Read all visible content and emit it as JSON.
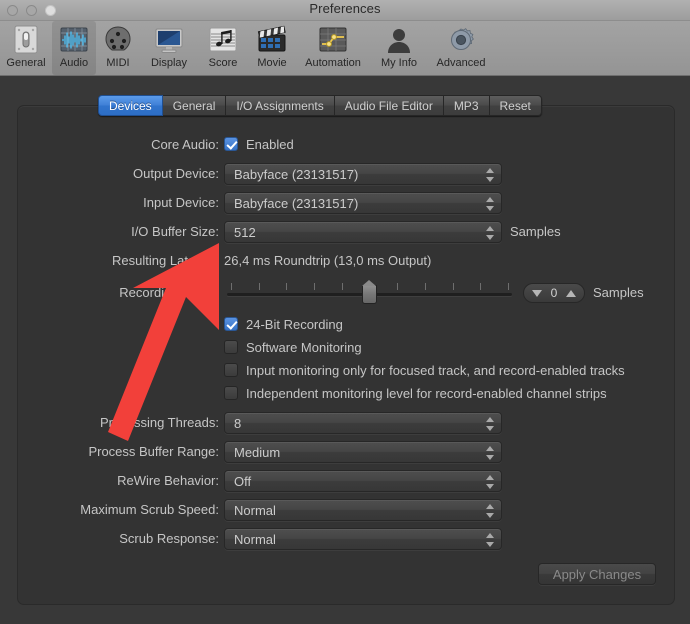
{
  "window": {
    "title": "Preferences",
    "traffic_lights": [
      "close",
      "minimize",
      "zoom"
    ]
  },
  "toolbar": {
    "items": [
      {
        "label": "General",
        "icon": "general-switch-icon",
        "selected": false
      },
      {
        "label": "Audio",
        "icon": "audio-waveform-icon",
        "selected": true
      },
      {
        "label": "MIDI",
        "icon": "midi-din-plug-icon",
        "selected": false
      },
      {
        "label": "Display",
        "icon": "display-monitor-icon",
        "selected": false
      },
      {
        "label": "Score",
        "icon": "score-notes-icon",
        "selected": false
      },
      {
        "label": "Movie",
        "icon": "movie-clapper-icon",
        "selected": false
      },
      {
        "label": "Automation",
        "icon": "automation-curve-icon",
        "selected": false
      },
      {
        "label": "My Info",
        "icon": "person-silhouette-icon",
        "selected": false
      },
      {
        "label": "Advanced",
        "icon": "gear-icon",
        "selected": false
      }
    ]
  },
  "tabs": [
    {
      "label": "Devices",
      "active": true
    },
    {
      "label": "General",
      "active": false
    },
    {
      "label": "I/O Assignments",
      "active": false
    },
    {
      "label": "Audio File Editor",
      "active": false
    },
    {
      "label": "MP3",
      "active": false
    },
    {
      "label": "Reset",
      "active": false
    }
  ],
  "form": {
    "core_audio": {
      "label": "Core Audio:",
      "checkbox_label": "Enabled",
      "checked": true
    },
    "output_device": {
      "label": "Output Device:",
      "value": "Babyface (23131517)"
    },
    "input_device": {
      "label": "Input Device:",
      "value": "Babyface (23131517)"
    },
    "io_buffer_size": {
      "label": "I/O Buffer Size:",
      "value": "512",
      "suffix": "Samples"
    },
    "resulting_latency": {
      "label": "Resulting Latency:",
      "value": "26,4 ms Roundtrip (13,0 ms Output)"
    },
    "recording_delay": {
      "label": "Recording Delay:",
      "value": "0",
      "suffix": "Samples",
      "slider_position_pct": 50,
      "tick_count": 11
    },
    "checkboxes": [
      {
        "label": "24-Bit Recording",
        "checked": true
      },
      {
        "label": "Software Monitoring",
        "checked": false
      },
      {
        "label": "Input monitoring only for focused track, and record-enabled tracks",
        "checked": false
      },
      {
        "label": "Independent monitoring level for record-enabled channel strips",
        "checked": false
      }
    ],
    "processing_threads": {
      "label": "Processing Threads:",
      "value": "8"
    },
    "process_buffer_range": {
      "label": "Process Buffer Range:",
      "value": "Medium"
    },
    "rewire_behavior": {
      "label": "ReWire Behavior:",
      "value": "Off"
    },
    "maximum_scrub_speed": {
      "label": "Maximum Scrub Speed:",
      "value": "Normal"
    },
    "scrub_response": {
      "label": "Scrub Response:",
      "value": "Normal"
    }
  },
  "apply_button": {
    "label": "Apply Changes",
    "enabled": false
  },
  "annotation": {
    "type": "arrow",
    "color": "#f2403a",
    "points_to": "I/O Buffer Size / Resulting Latency area"
  },
  "colors": {
    "accent_blue": "#3f7fd6",
    "panel_bg": "#333333",
    "window_bg": "#383838",
    "toolbar_bg": "#9b9b9b",
    "text": "#c6c6c6",
    "annotation_red": "#f2403a"
  }
}
